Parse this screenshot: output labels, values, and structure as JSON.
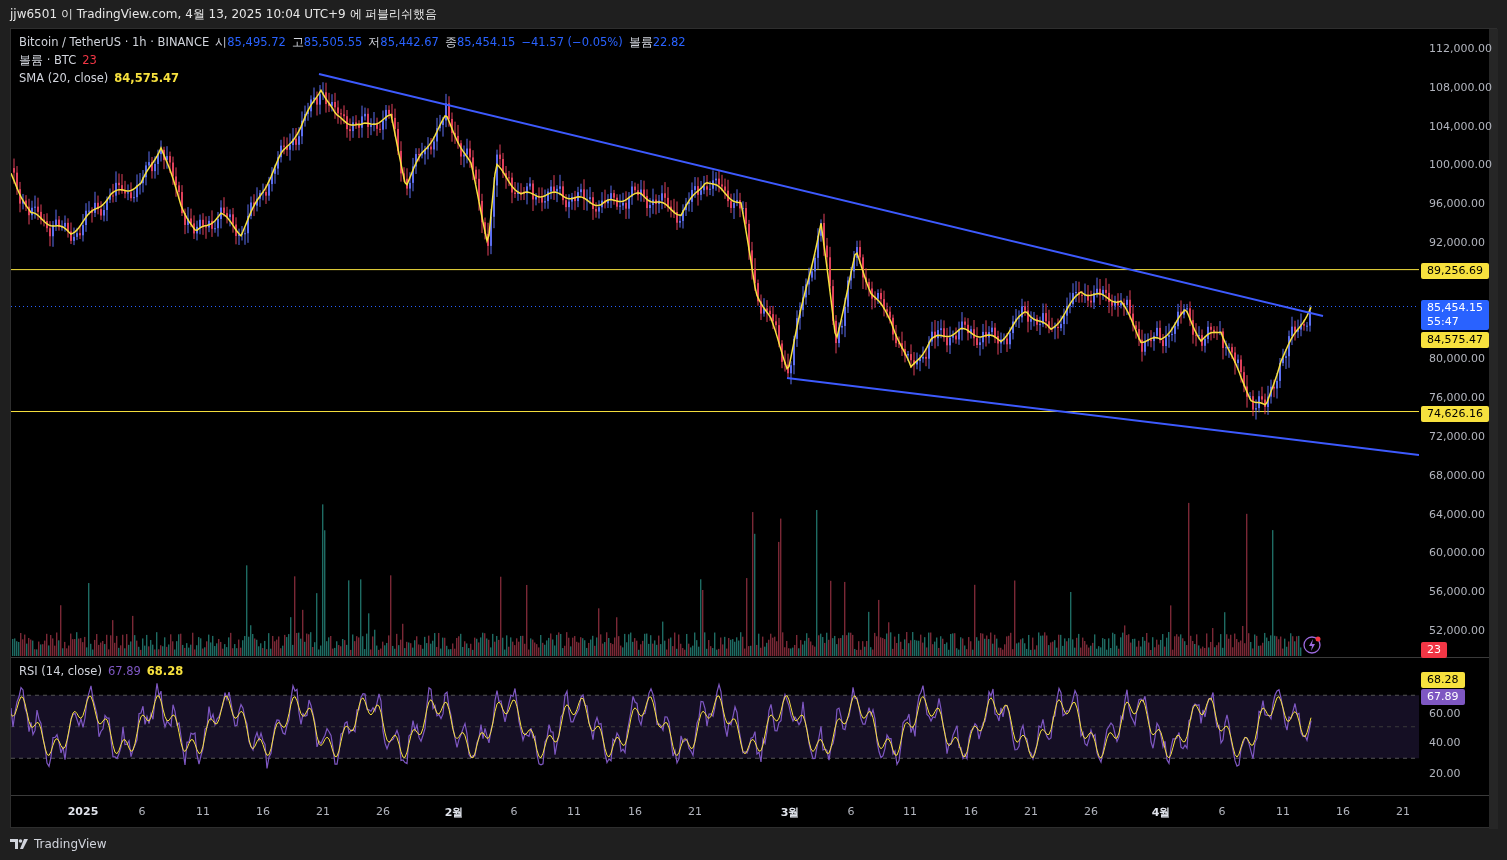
{
  "header": {
    "title": "jjw6501 이 TradingView.com, 4월 13, 2025 10:04 UTC+9 에 퍼블리쉬했음"
  },
  "legend": {
    "symbol": "Bitcoin / TetherUS · 1h · BINANCE",
    "ohlc": [
      {
        "label": "시",
        "value": "85,495.72"
      },
      {
        "label": "고",
        "value": "85,505.55"
      },
      {
        "label": "저",
        "value": "85,442.67"
      },
      {
        "label": "종",
        "value": "85,454.15"
      }
    ],
    "change": "−41.57 (−0.05%)",
    "volume": {
      "label": "볼륨",
      "value": "22.82"
    },
    "indicators": [
      {
        "name": "볼륨 · BTC",
        "value": "23",
        "color": "#f23645"
      },
      {
        "name": "SMA (20, close)",
        "value": "84,575.47",
        "color": "#f7e13e"
      }
    ]
  },
  "price_axis": [
    "112,000.00",
    "108,000.00",
    "104,000.00",
    "100,000.00",
    "96,000.00",
    "92,000.00",
    "80,000.00",
    "76,000.00",
    "72,000.00",
    "68,000.00",
    "64,000.00",
    "60,000.00",
    "56,000.00",
    "52,000.00"
  ],
  "price_badges": [
    {
      "value": "89,256.69",
      "color": "#f7e13e"
    },
    {
      "value": "85,454.15",
      "sub": "55:47",
      "color": "#2962ff"
    },
    {
      "value": "84,575.47",
      "color": "#f7e13e"
    },
    {
      "value": "74,626.16",
      "color": "#f7e13e"
    },
    {
      "value": "23",
      "color": "#f23645"
    }
  ],
  "rsi": {
    "title": "RSI (14, close)",
    "values": [
      {
        "value": "67.89",
        "color": "#7e57c2"
      },
      {
        "value": "68.28",
        "color": "#f7e13e"
      }
    ],
    "axis": [
      "60.00",
      "40.00",
      "20.00"
    ],
    "badges": [
      {
        "value": "68.28",
        "color": "#f7e13e"
      },
      {
        "value": "67.89",
        "color": "#7e57c2"
      }
    ]
  },
  "time_axis": [
    {
      "label": "2025",
      "kind": "year"
    },
    {
      "label": "6",
      "kind": "day"
    },
    {
      "label": "11",
      "kind": "day"
    },
    {
      "label": "16",
      "kind": "day"
    },
    {
      "label": "21",
      "kind": "day"
    },
    {
      "label": "26",
      "kind": "day"
    },
    {
      "label": "2월",
      "kind": "month"
    },
    {
      "label": "6",
      "kind": "day"
    },
    {
      "label": "11",
      "kind": "day"
    },
    {
      "label": "16",
      "kind": "day"
    },
    {
      "label": "21",
      "kind": "day"
    },
    {
      "label": "3월",
      "kind": "month"
    },
    {
      "label": "6",
      "kind": "day"
    },
    {
      "label": "11",
      "kind": "day"
    },
    {
      "label": "16",
      "kind": "day"
    },
    {
      "label": "21",
      "kind": "day"
    },
    {
      "label": "26",
      "kind": "day"
    },
    {
      "label": "4월",
      "kind": "month"
    },
    {
      "label": "6",
      "kind": "day"
    },
    {
      "label": "11",
      "kind": "day"
    },
    {
      "label": "16",
      "kind": "day"
    },
    {
      "label": "21",
      "kind": "day"
    }
  ],
  "footer": {
    "brand": "TradingView"
  }
}
